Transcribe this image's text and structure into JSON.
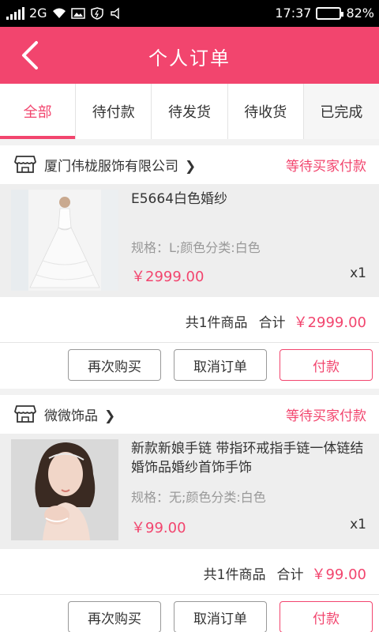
{
  "status_bar": {
    "sim_label": "2G",
    "time": "17:37",
    "battery_percent": "82%",
    "battery_level": 0.82
  },
  "header": {
    "title": "个人订单"
  },
  "tabs": [
    {
      "label": "全部",
      "active": true
    },
    {
      "label": "待付款",
      "active": false
    },
    {
      "label": "待发货",
      "active": false
    },
    {
      "label": "待收货",
      "active": false
    },
    {
      "label": "已完成",
      "active": false
    }
  ],
  "orders": [
    {
      "shop_name": "厦门伟栊服饰有限公司",
      "status": "等待买家付款",
      "item": {
        "title": "E5664白色婚纱",
        "spec": "规格：L;颜色分类:白色",
        "price": "￥2999.00",
        "qty": "x1"
      },
      "total": {
        "count_text": "共1件商品",
        "label": "合计",
        "amount": "￥2999.00"
      },
      "actions": {
        "rebuy": "再次购买",
        "cancel": "取消订单",
        "pay": "付款"
      }
    },
    {
      "shop_name": "微微饰品",
      "status": "等待买家付款",
      "item": {
        "title": "新款新娘手链 带指环戒指手链一体链结婚饰品婚纱首饰手饰",
        "spec": "规格：无;颜色分类:白色",
        "price": "￥99.00",
        "qty": "x1"
      },
      "total": {
        "count_text": "共1件商品",
        "label": "合计",
        "amount": "￥99.00"
      },
      "actions": {
        "rebuy": "再次购买",
        "cancel": "取消订单",
        "pay": "付款"
      }
    }
  ],
  "colors": {
    "accent": "#f2456e",
    "status_bar": "#000000",
    "battery_fill": "#3fd23f"
  }
}
